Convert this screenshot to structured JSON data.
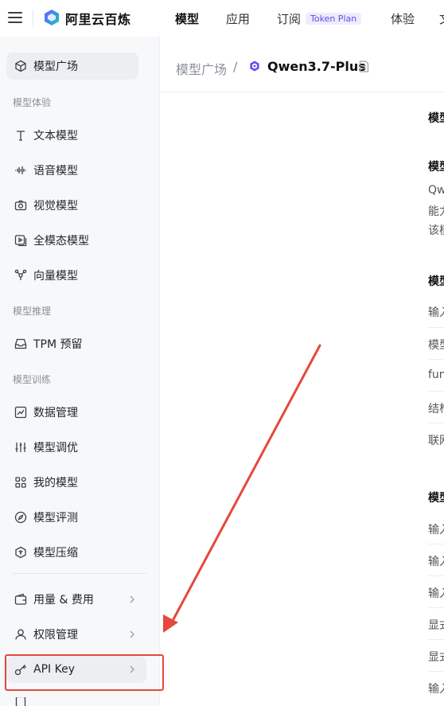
{
  "header": {
    "brand": "阿里云百炼",
    "nav": [
      {
        "label": "模型",
        "active": true
      },
      {
        "label": "应用",
        "active": false
      },
      {
        "label": "订阅",
        "active": false
      },
      {
        "label": "体验",
        "active": false
      },
      {
        "label": "文",
        "active": false
      }
    ],
    "token_plan_badge": "Token Plan"
  },
  "sidebar": {
    "top_item": "模型广场",
    "groups": {
      "experience": "模型体验",
      "inference": "模型推理",
      "training": "模型训练"
    },
    "items": {
      "text_model": "文本模型",
      "voice_model": "语音模型",
      "vision_model": "视觉模型",
      "omni_model": "全模态模型",
      "vector_model": "向量模型",
      "tpm": "TPM 预留",
      "data_mgmt": "数据管理",
      "finetune": "模型调优",
      "my_models": "我的模型",
      "eval": "模型评测",
      "compress": "模型压缩",
      "usage": "用量 & 费用",
      "permissions": "权限管理",
      "api_key": "API Key"
    }
  },
  "breadcrumb": {
    "home": "模型广场",
    "separator": "/",
    "current": "Qwen3.7-Plus"
  },
  "content": {
    "col_header": "模型",
    "intro_title": "模型",
    "intro_lines": [
      "Qw",
      "能力",
      "该模"
    ],
    "section1_title": "模型",
    "section1_rows": [
      "输入",
      "模型",
      "fun",
      "结构",
      "联网"
    ],
    "section2_title": "模型",
    "section2_rows": [
      "输入",
      "输入",
      "输入",
      "显式",
      "显式",
      "输入"
    ]
  },
  "colors": {
    "accent": "#5b4fe6",
    "highlight": "#e5483c",
    "sidebar_bg": "#f7f8fa"
  }
}
